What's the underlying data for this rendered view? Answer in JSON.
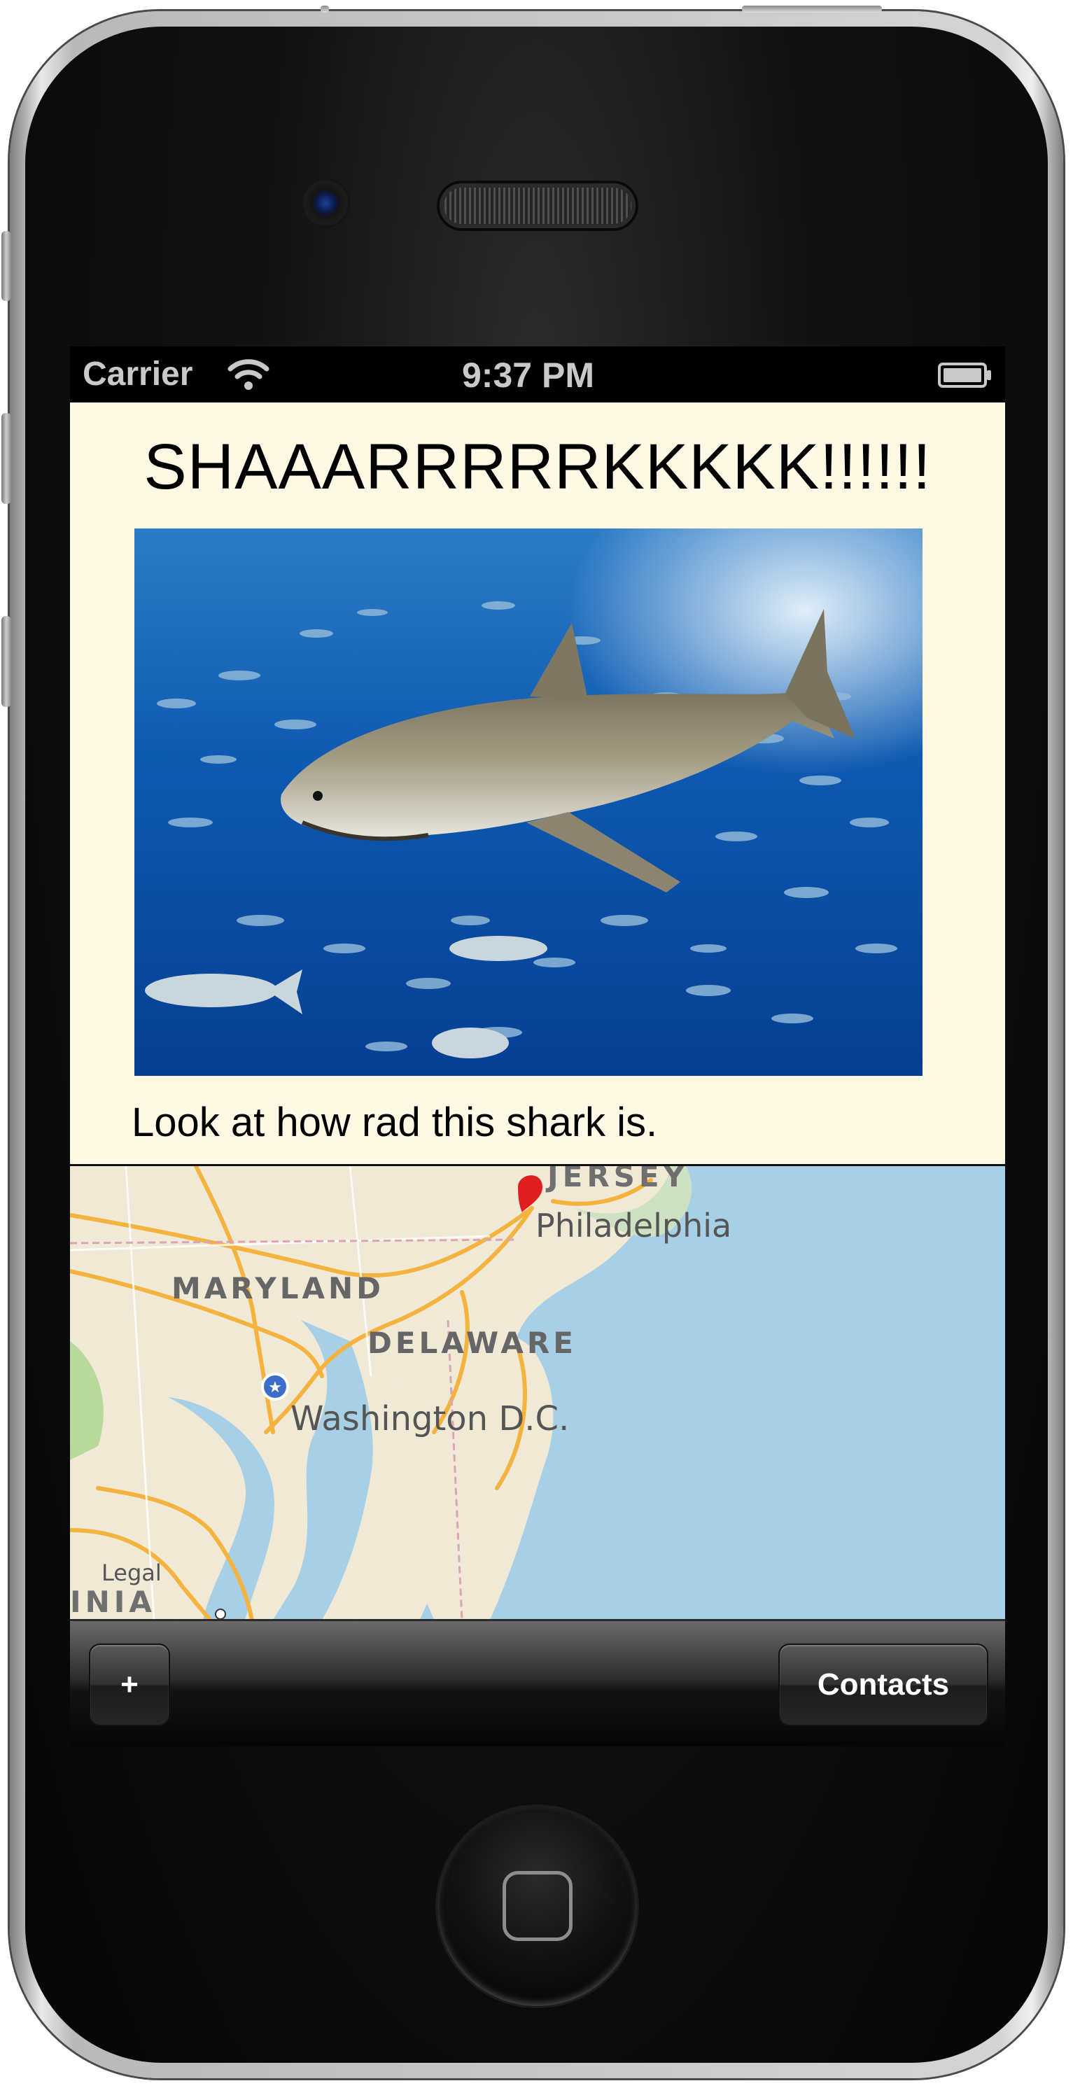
{
  "status_bar": {
    "carrier": "Carrier",
    "time": "9:37 PM"
  },
  "content": {
    "title": "SHAAARRRRRKKKKK!!!!!!",
    "caption": "Look at how rad this shark is.",
    "background_color": "#fdf9e5"
  },
  "map": {
    "labels": {
      "jersey": "JERSEY",
      "philadelphia": "Philadelphia",
      "maryland": "MARYLAND",
      "delaware": "DELAWARE",
      "washington": "Washington D.C.",
      "legal": "Legal",
      "partial_state": "INIA"
    },
    "pin_color": "#e02020",
    "water_color": "#a7cfe6",
    "land_color": "#efe9d6"
  },
  "toolbar": {
    "add_label": "+",
    "contacts_label": "Contacts"
  }
}
